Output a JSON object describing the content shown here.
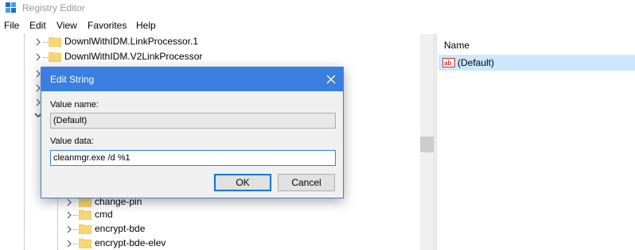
{
  "window": {
    "title": "Registry Editor"
  },
  "menu": {
    "items": [
      "File",
      "Edit",
      "View",
      "Favorites",
      "Help"
    ]
  },
  "tree": {
    "items": [
      {
        "label": "DownlWithIDM.LinkProcessor.1"
      },
      {
        "label": "DownlWithIDM.V2LinkProcessor"
      },
      {
        "label": "change-pin"
      },
      {
        "label": "cmd"
      },
      {
        "label": "encrypt-bde"
      },
      {
        "label": "encrypt-bde-elev"
      }
    ]
  },
  "values_pane": {
    "column_name": "Name",
    "rows": [
      {
        "name": "(Default)",
        "icon": "string-value-icon"
      }
    ]
  },
  "dialog": {
    "title": "Edit String",
    "value_name_label": "Value name:",
    "value_name": "(Default)",
    "value_data_label": "Value data:",
    "value_data": "cleanmgr.exe /d %1",
    "ok_label": "OK",
    "cancel_label": "Cancel"
  },
  "colors": {
    "accent": "#3a7ee0",
    "selection": "#cce8ff",
    "folder": "#f7d774"
  }
}
